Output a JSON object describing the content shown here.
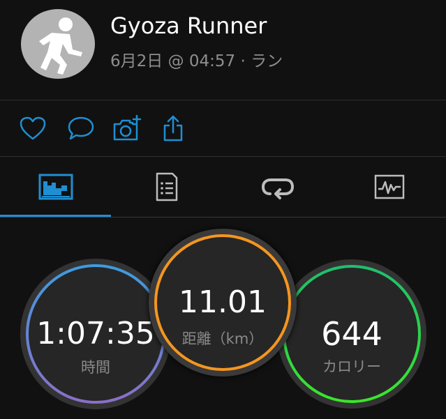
{
  "activity": {
    "user_name": "Gyoza Runner",
    "subtitle": "6月2日 @ 04:57 · ラン"
  },
  "actions": [
    {
      "icon": "heart-icon"
    },
    {
      "icon": "comment-icon"
    },
    {
      "icon": "add-photo-icon"
    },
    {
      "icon": "share-icon"
    }
  ],
  "tabs": [
    {
      "icon": "summary-chart-icon",
      "selected": true
    },
    {
      "icon": "details-list-icon",
      "selected": false
    },
    {
      "icon": "laps-icon",
      "selected": false
    },
    {
      "icon": "heart-rate-chart-icon",
      "selected": false
    }
  ],
  "metrics": {
    "time": {
      "value": "1:07:35",
      "label": "時間"
    },
    "distance": {
      "value": "11.01",
      "label": "距離（km）"
    },
    "calories": {
      "value": "644",
      "label": "カロリー"
    }
  },
  "colors": {
    "accent": "#1f8fd2",
    "distance_ring": "#f5961f",
    "time_ring_top": "#3e9be0",
    "time_ring_bottom": "#8b6fc7",
    "calories_ring": "#28d34a"
  }
}
